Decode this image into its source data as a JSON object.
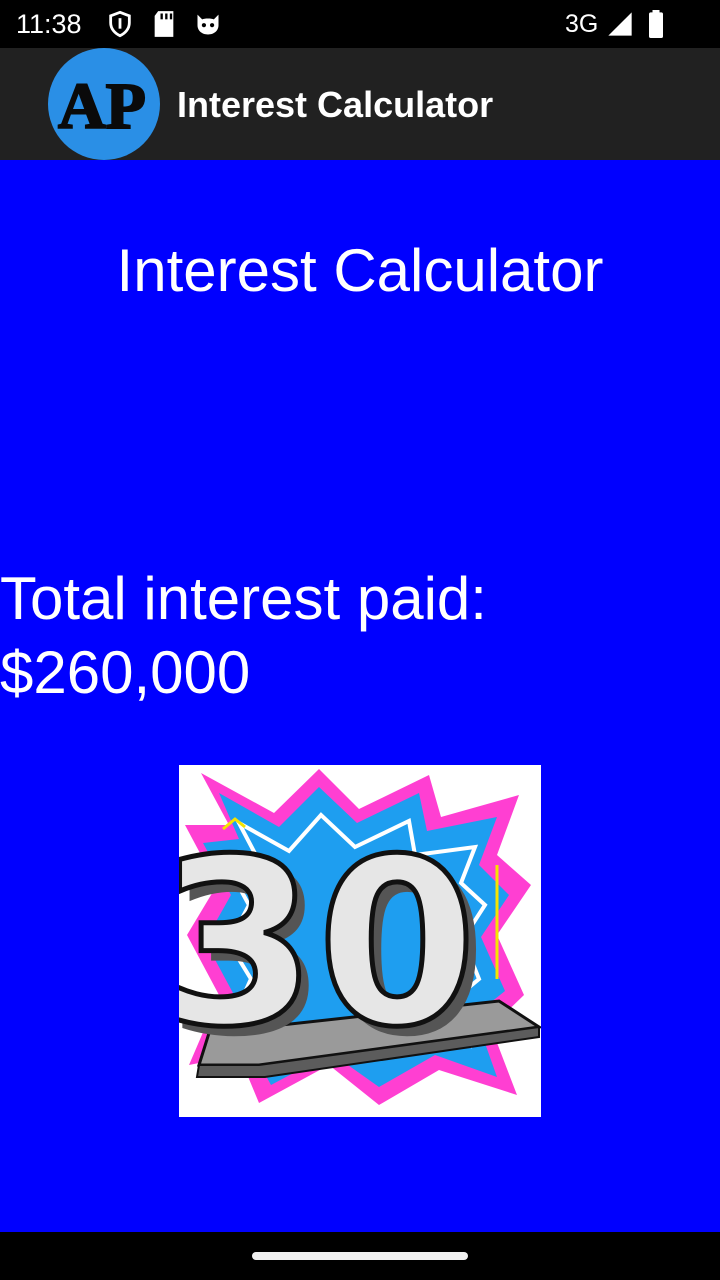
{
  "status_bar": {
    "time": "11:38",
    "network": "3G",
    "icons": [
      "shield-icon",
      "sd-card-icon",
      "cat-face-icon",
      "signal-icon",
      "battery-icon"
    ]
  },
  "app_bar": {
    "logo_text": "AP",
    "title": "Interest Calculator"
  },
  "main": {
    "title": "Interest Calculator",
    "result_label": "Total interest paid:",
    "result_value": "$260,000",
    "image": {
      "description_icon": "thirty-years-trophy-icon",
      "number": "30"
    }
  },
  "colors": {
    "status_bar": "#000000",
    "app_bar": "#212121",
    "content_bg": "#0000ff",
    "text": "#ffffff",
    "logo_circle": "#2a8fe6"
  }
}
